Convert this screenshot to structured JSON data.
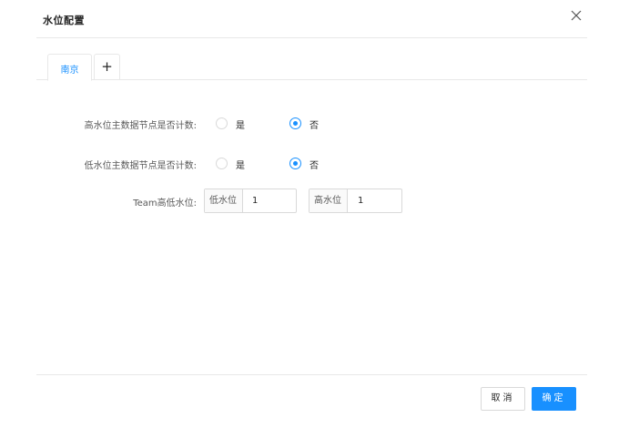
{
  "dialog": {
    "title": "水位配置"
  },
  "tabs": [
    {
      "label": "南京",
      "active": true
    },
    {
      "label": "+"
    }
  ],
  "form": {
    "high_water_count": {
      "label": "高水位主数据节点是否计数:",
      "options": [
        "是",
        "否"
      ],
      "selected": "否"
    },
    "low_water_count": {
      "label": "低水位主数据节点是否计数:",
      "options": [
        "是",
        "否"
      ],
      "selected": "否"
    },
    "team_water": {
      "label": "Team高低水位:",
      "low": {
        "addon": "低水位",
        "value": "1"
      },
      "high": {
        "addon": "高水位",
        "value": "1"
      }
    }
  },
  "footer": {
    "cancel_label": "取消",
    "ok_label": "确定"
  },
  "colors": {
    "primary": "#1890ff",
    "border": "#e8e8e8"
  }
}
